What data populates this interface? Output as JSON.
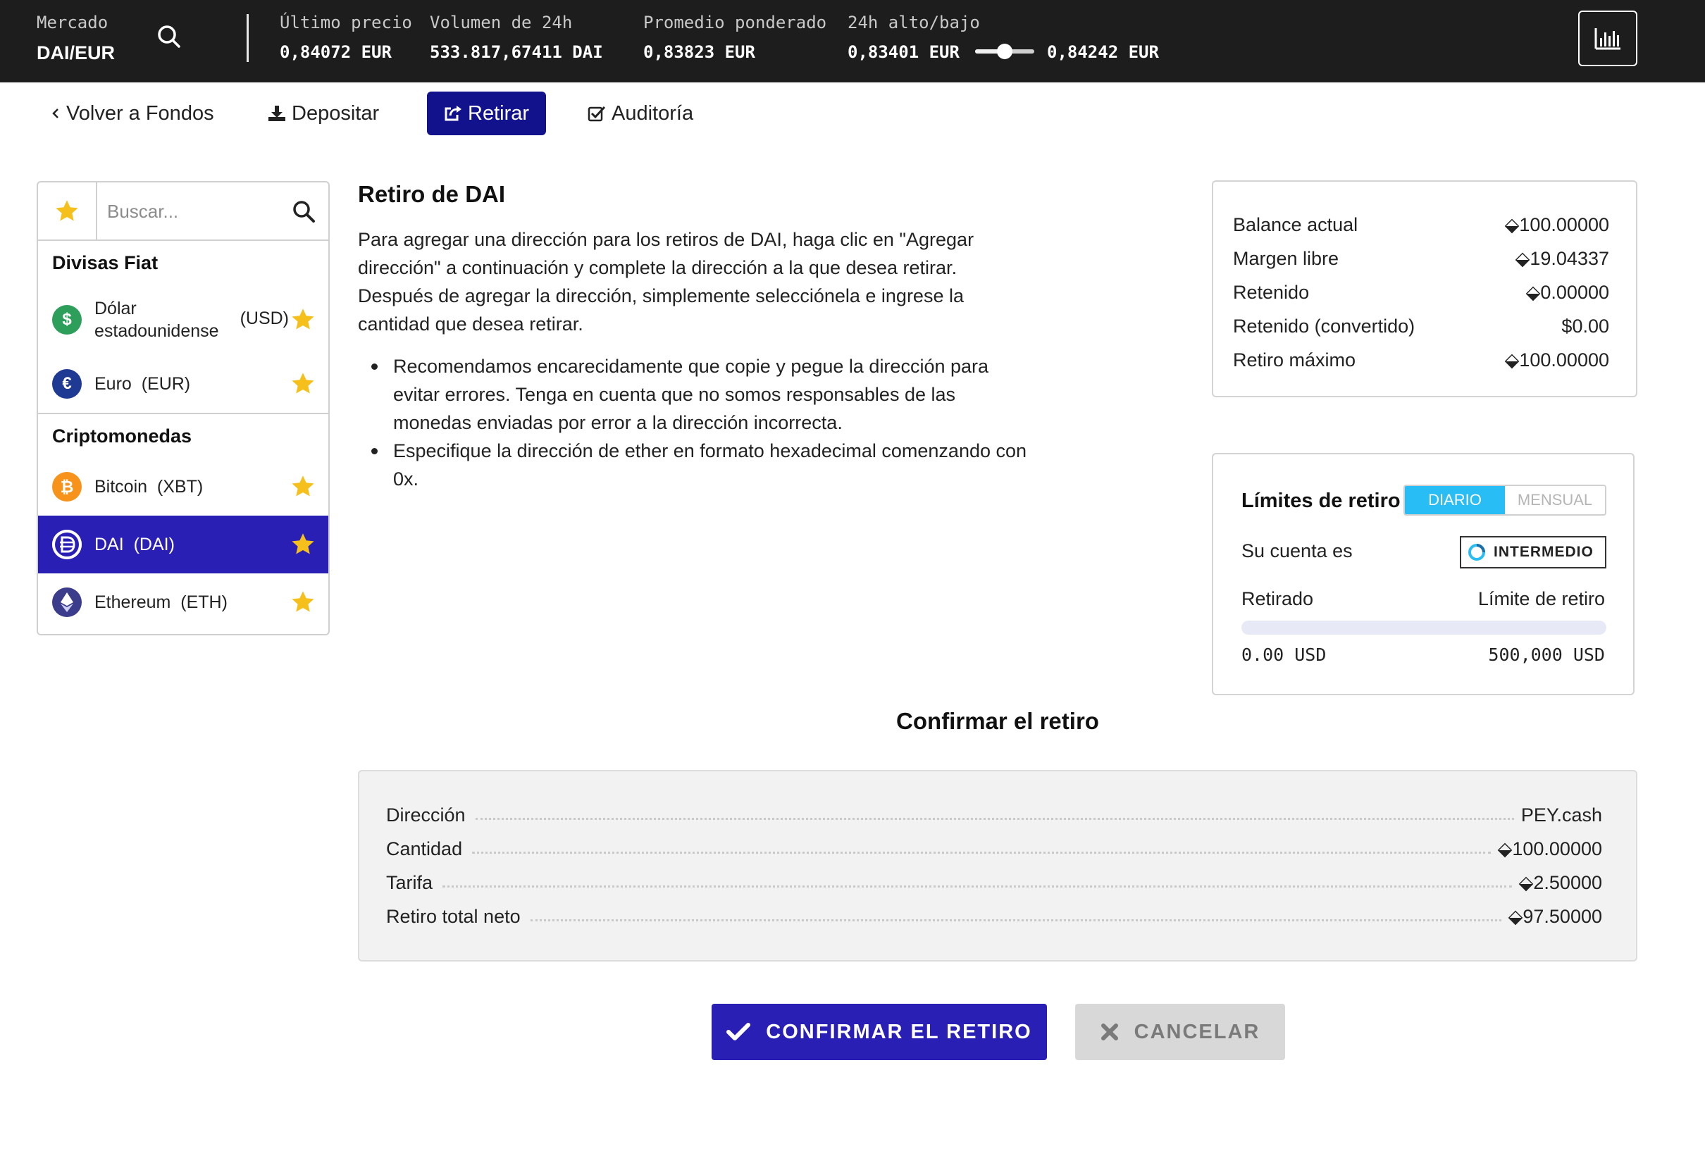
{
  "market": {
    "label": "Mercado",
    "pair": "DAI/EUR",
    "last_price_label": "Último precio",
    "last_price": "0,84072 EUR",
    "volume_label": "Volumen de 24h",
    "volume": "533.817,67411 DAI",
    "weighted_label": "Promedio ponderado",
    "weighted": "0,83823 EUR",
    "range_label": "24h alto/bajo",
    "low": "0,83401 EUR",
    "high": "0,84242 EUR",
    "range_position": 0.5
  },
  "subnav": {
    "back": "Volver a Fondos",
    "deposit": "Depositar",
    "withdraw": "Retirar",
    "audit": "Auditoría"
  },
  "currencies": {
    "search_placeholder": "Buscar...",
    "fiat_heading": "Divisas Fiat",
    "crypto_heading": "Criptomonedas",
    "fiat": [
      {
        "name_line1": "Dólar",
        "name_line2": "estadounidense",
        "code": "(USD)",
        "icon": "dollar-icon",
        "color": "#2e9f5a"
      },
      {
        "name": "Euro  (EUR)",
        "icon": "euro-icon",
        "color": "#1f3a93"
      }
    ],
    "crypto": [
      {
        "name": "Bitcoin  (XBT)",
        "icon": "bitcoin-icon",
        "color": "#f7931a"
      },
      {
        "name": "DAI  (DAI)",
        "icon": "dai-icon",
        "color": "#2a1fb5",
        "selected": true
      },
      {
        "name": "Ethereum  (ETH)",
        "icon": "ethereum-icon",
        "color": "#3c3c8c"
      }
    ],
    "star_color": "#f5c01b"
  },
  "main": {
    "title": "Retiro de DAI",
    "paragraph": "Para agregar una dirección para los retiros de DAI, haga clic en \"Agregar dirección\" a continuación y complete la dirección a la que desea retirar. Después de agregar la dirección, simplemente selecciónela e ingrese la cantidad que desea retirar.",
    "bullets": [
      "Recomendamos encarecidamente que copie y pegue la dirección para evitar errores. Tenga en cuenta que no somos responsables de las monedas enviadas por error a la dirección incorrecta.",
      "Especifique la dirección de ether en formato hexadecimal comenzando con 0x."
    ]
  },
  "balance": {
    "rows": [
      {
        "label": "Balance actual",
        "value": "⬙100.00000"
      },
      {
        "label": "Margen libre",
        "value": "⬙19.04337"
      },
      {
        "label": "Retenido",
        "value": "⬙0.00000"
      },
      {
        "label": "Retenido (convertido)",
        "value": "$0.00"
      },
      {
        "label": "Retiro máximo",
        "value": "⬙100.00000"
      }
    ]
  },
  "limits": {
    "title": "Límites de retiro",
    "daily": "DIARIO",
    "monthly": "MENSUAL",
    "account_label": "Su cuenta es",
    "account_level": "INTERMEDIO",
    "withdrawn_label": "Retirado",
    "limit_label": "Límite de retiro",
    "withdrawn": "0.00 USD",
    "limit": "500,000 USD",
    "progress_fraction": 0.0
  },
  "confirm": {
    "title": "Confirmar el retiro",
    "rows": [
      {
        "label": "Dirección",
        "value": "PEY.cash"
      },
      {
        "label": "Cantidad",
        "value": "⬙100.00000"
      },
      {
        "label": "Tarifa",
        "value": "⬙2.50000"
      },
      {
        "label": "Retiro total neto",
        "value": "⬙97.50000"
      }
    ],
    "confirm_button": "CONFIRMAR EL RETIRO",
    "cancel_button": "CANCELAR"
  },
  "colors": {
    "accent": "#2a1fb5",
    "nav_active": "#12128c",
    "toggle_on": "#28bdf5",
    "topbar": "#1d1d1d"
  }
}
